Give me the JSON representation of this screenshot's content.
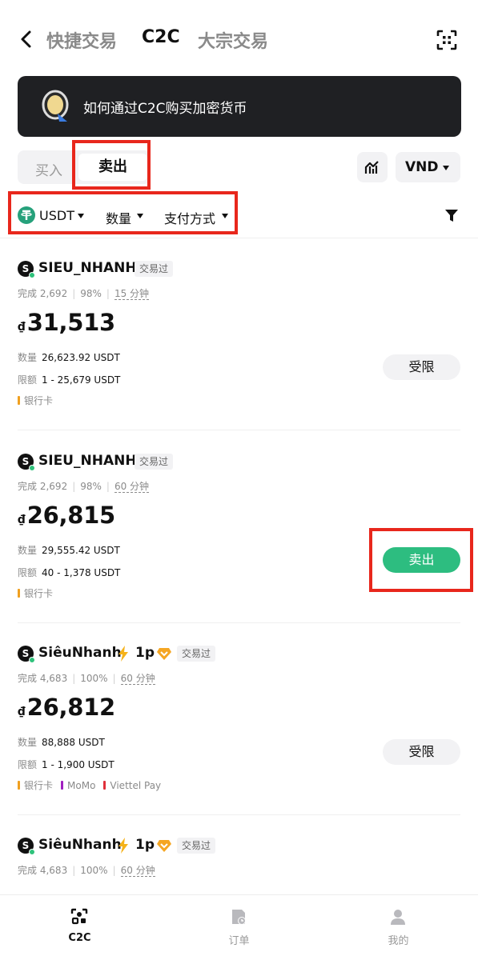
{
  "header": {
    "tabs": [
      {
        "label": "快捷交易",
        "active": false
      },
      {
        "label": "C2C",
        "active": true
      },
      {
        "label": "大宗交易",
        "active": false
      }
    ]
  },
  "banner": {
    "text": "如何通过C2C购买加密货币"
  },
  "trade_side": {
    "buy_label": "买入",
    "sell_label": "卖出",
    "selected": "卖出"
  },
  "fiat": {
    "label": "VND"
  },
  "filters": {
    "asset": "USDT",
    "amount": "数量",
    "payment": "支付方式"
  },
  "listings": [
    {
      "name": "SIEU_NHANH",
      "avatar_letter": "S",
      "traded_tag": "交易过",
      "completed_label": "完成",
      "completed": "2,692",
      "rate": "98%",
      "time": "15 分钟",
      "currency_symbol": "₫",
      "price": "31,513",
      "quantity_label": "数量",
      "quantity": "26,623.92 USDT",
      "limit_label": "限额",
      "limit": "1 - 25,679 USDT",
      "payments": [
        {
          "name": "银行卡",
          "color": "#f0a020"
        }
      ],
      "action": "受限",
      "action_type": "restricted"
    },
    {
      "name": "SIEU_NHANH",
      "avatar_letter": "S",
      "traded_tag": "交易过",
      "completed_label": "完成",
      "completed": "2,692",
      "rate": "98%",
      "time": "60 分钟",
      "currency_symbol": "₫",
      "price": "26,815",
      "quantity_label": "数量",
      "quantity": "29,555.42 USDT",
      "limit_label": "限额",
      "limit": "40 - 1,378 USDT",
      "payments": [
        {
          "name": "银行卡",
          "color": "#f0a020"
        }
      ],
      "action": "卖出",
      "action_type": "sell"
    },
    {
      "name": "SiêuNhanh",
      "name_suffix": "1p",
      "avatar_letter": "S",
      "traded_tag": "交易过",
      "completed_label": "完成",
      "completed": "4,683",
      "rate": "100%",
      "time": "60 分钟",
      "currency_symbol": "₫",
      "price": "26,812",
      "quantity_label": "数量",
      "quantity": "88,888 USDT",
      "limit_label": "限额",
      "limit": "1 - 1,900 USDT",
      "payments": [
        {
          "name": "银行卡",
          "color": "#f0a020"
        },
        {
          "name": "MoMo",
          "color": "#a020c0"
        },
        {
          "name": "Viettel Pay",
          "color": "#e0303a"
        }
      ],
      "action": "受限",
      "action_type": "restricted"
    },
    {
      "name": "SiêuNhanh",
      "name_suffix": "1p",
      "avatar_letter": "S",
      "traded_tag": "交易过",
      "completed_label": "完成",
      "completed": "4,683",
      "rate": "100%",
      "time": "60 分钟"
    }
  ],
  "bottom_nav": [
    {
      "label": "C2C",
      "icon": "c2c-icon",
      "active": true
    },
    {
      "label": "订单",
      "icon": "orders-icon",
      "active": false
    },
    {
      "label": "我的",
      "icon": "profile-icon",
      "active": false
    }
  ],
  "colors": {
    "accent_green": "#2dbd80",
    "highlight_red": "#e8271c",
    "usdt_green": "#26a17b"
  }
}
